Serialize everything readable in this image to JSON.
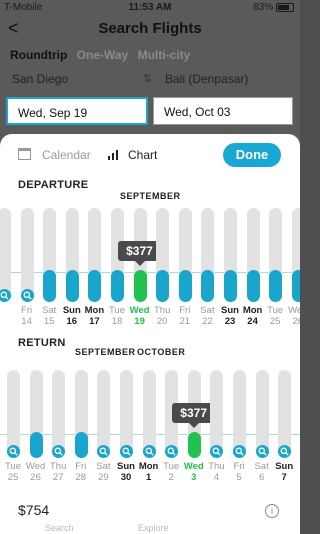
{
  "status": {
    "carrier": "T-Mobile",
    "time": "11:53 AM",
    "battery": "83%"
  },
  "header": {
    "back": "<",
    "title": "Search Flights"
  },
  "trip_tabs": [
    "Roundtrip",
    "One-Way",
    "Multi-city"
  ],
  "route": {
    "origin": "San Diego",
    "destination": "Bali (Denpasar)"
  },
  "dates": {
    "depart": "Wed, Sep 19",
    "return": "Wed, Oct 03"
  },
  "panel": {
    "tab_calendar": "Calendar",
    "tab_chart": "Chart",
    "done": "Done",
    "departure_label": "DEPARTURE",
    "return_label": "RETURN",
    "departure_month": "SEPTEMBER",
    "return_months": [
      "SEPTEMBER",
      "OCTOBER"
    ],
    "departure_price": "$377",
    "return_price": "$377",
    "total": "$754",
    "below_labels": [
      "Search",
      "Explore"
    ]
  },
  "colors": {
    "accent": "#18a8d2",
    "selected": "#22c24f",
    "bar": "#1aa6cc",
    "track": "#e2e2e2"
  },
  "departure_days": [
    {
      "dow": "",
      "num": "",
      "state": "dot"
    },
    {
      "dow": "Fri",
      "num": "14",
      "state": "dot"
    },
    {
      "dow": "Sat",
      "num": "15",
      "state": "bar"
    },
    {
      "dow": "Sun",
      "num": "16",
      "state": "bar",
      "we": true
    },
    {
      "dow": "Mon",
      "num": "17",
      "state": "bar",
      "we": true
    },
    {
      "dow": "Tue",
      "num": "18",
      "state": "bar"
    },
    {
      "dow": "Wed",
      "num": "19",
      "state": "sel"
    },
    {
      "dow": "Thu",
      "num": "20",
      "state": "bar"
    },
    {
      "dow": "Fri",
      "num": "21",
      "state": "bar"
    },
    {
      "dow": "Sat",
      "num": "22",
      "state": "bar"
    },
    {
      "dow": "Sun",
      "num": "23",
      "state": "bar",
      "we": true
    },
    {
      "dow": "Mon",
      "num": "24",
      "state": "bar",
      "we": true
    },
    {
      "dow": "Tue",
      "num": "25",
      "state": "bar"
    },
    {
      "dow": "Wed",
      "num": "26",
      "state": "bar"
    }
  ],
  "return_days": [
    {
      "dow": "Tue",
      "num": "25",
      "state": "dot"
    },
    {
      "dow": "Wed",
      "num": "26",
      "state": "bar"
    },
    {
      "dow": "Thu",
      "num": "27",
      "state": "dot"
    },
    {
      "dow": "Fri",
      "num": "28",
      "state": "bar"
    },
    {
      "dow": "Sat",
      "num": "29",
      "state": "dot"
    },
    {
      "dow": "Sun",
      "num": "30",
      "state": "dot",
      "we": true
    },
    {
      "dow": "Mon",
      "num": "1",
      "state": "dot",
      "we": true
    },
    {
      "dow": "Tue",
      "num": "2",
      "state": "dot"
    },
    {
      "dow": "Wed",
      "num": "3",
      "state": "sel"
    },
    {
      "dow": "Thu",
      "num": "4",
      "state": "dot"
    },
    {
      "dow": "Fri",
      "num": "5",
      "state": "dot"
    },
    {
      "dow": "Sat",
      "num": "6",
      "state": "dot"
    },
    {
      "dow": "Sun",
      "num": "7",
      "state": "dot",
      "we": true
    },
    {
      "dow": "",
      "num": "",
      "state": "dot"
    }
  ]
}
